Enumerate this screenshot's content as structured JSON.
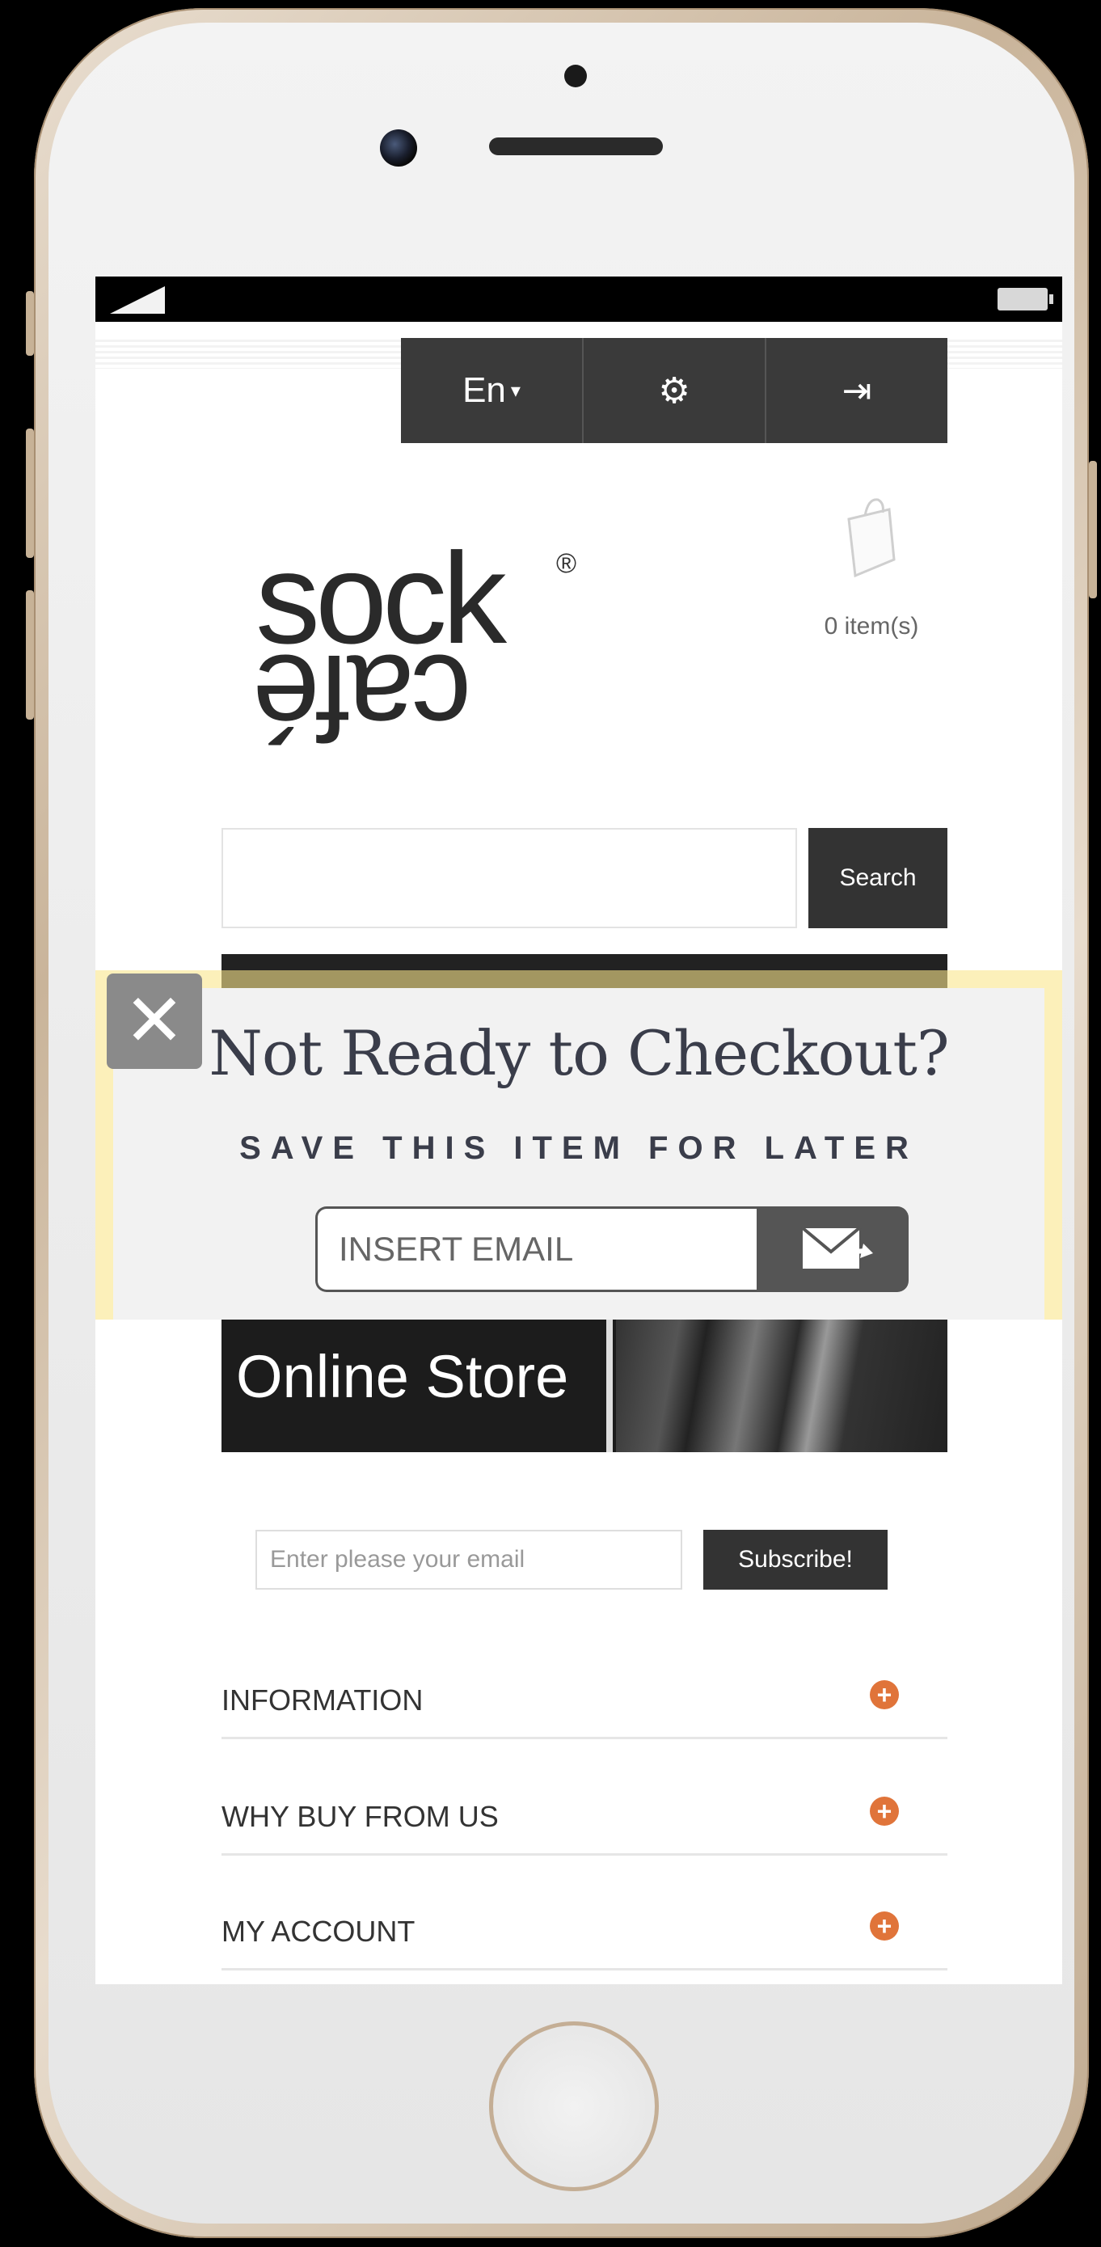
{
  "toolbar": {
    "language": "En",
    "language_caret": "▾",
    "settings_icon": "⚙",
    "login_icon": "⇥"
  },
  "brand": {
    "logo_top": "sock",
    "logo_bottom": "café",
    "logo_registered": "®"
  },
  "cart": {
    "count_label": "0 item(s)"
  },
  "search": {
    "value": "",
    "button_label": "Search"
  },
  "popup": {
    "title": "Not Ready to Checkout?",
    "subtitle": "SAVE THIS ITEM FOR LATER",
    "email_placeholder": "INSERT EMAIL",
    "close_icon": "✕"
  },
  "banner": {
    "text": "Online Store"
  },
  "newsletter": {
    "placeholder": "Enter please your email",
    "button_label": "Subscribe!"
  },
  "footer": {
    "sections": [
      {
        "label": "INFORMATION",
        "icon": "+"
      },
      {
        "label": "WHY BUY FROM US",
        "icon": "+"
      },
      {
        "label": "MY ACCOUNT",
        "icon": "+"
      }
    ]
  },
  "colors": {
    "toolbar": "#3a3a3a",
    "accent": "#e0743a",
    "popup_border": "#fae68c"
  }
}
